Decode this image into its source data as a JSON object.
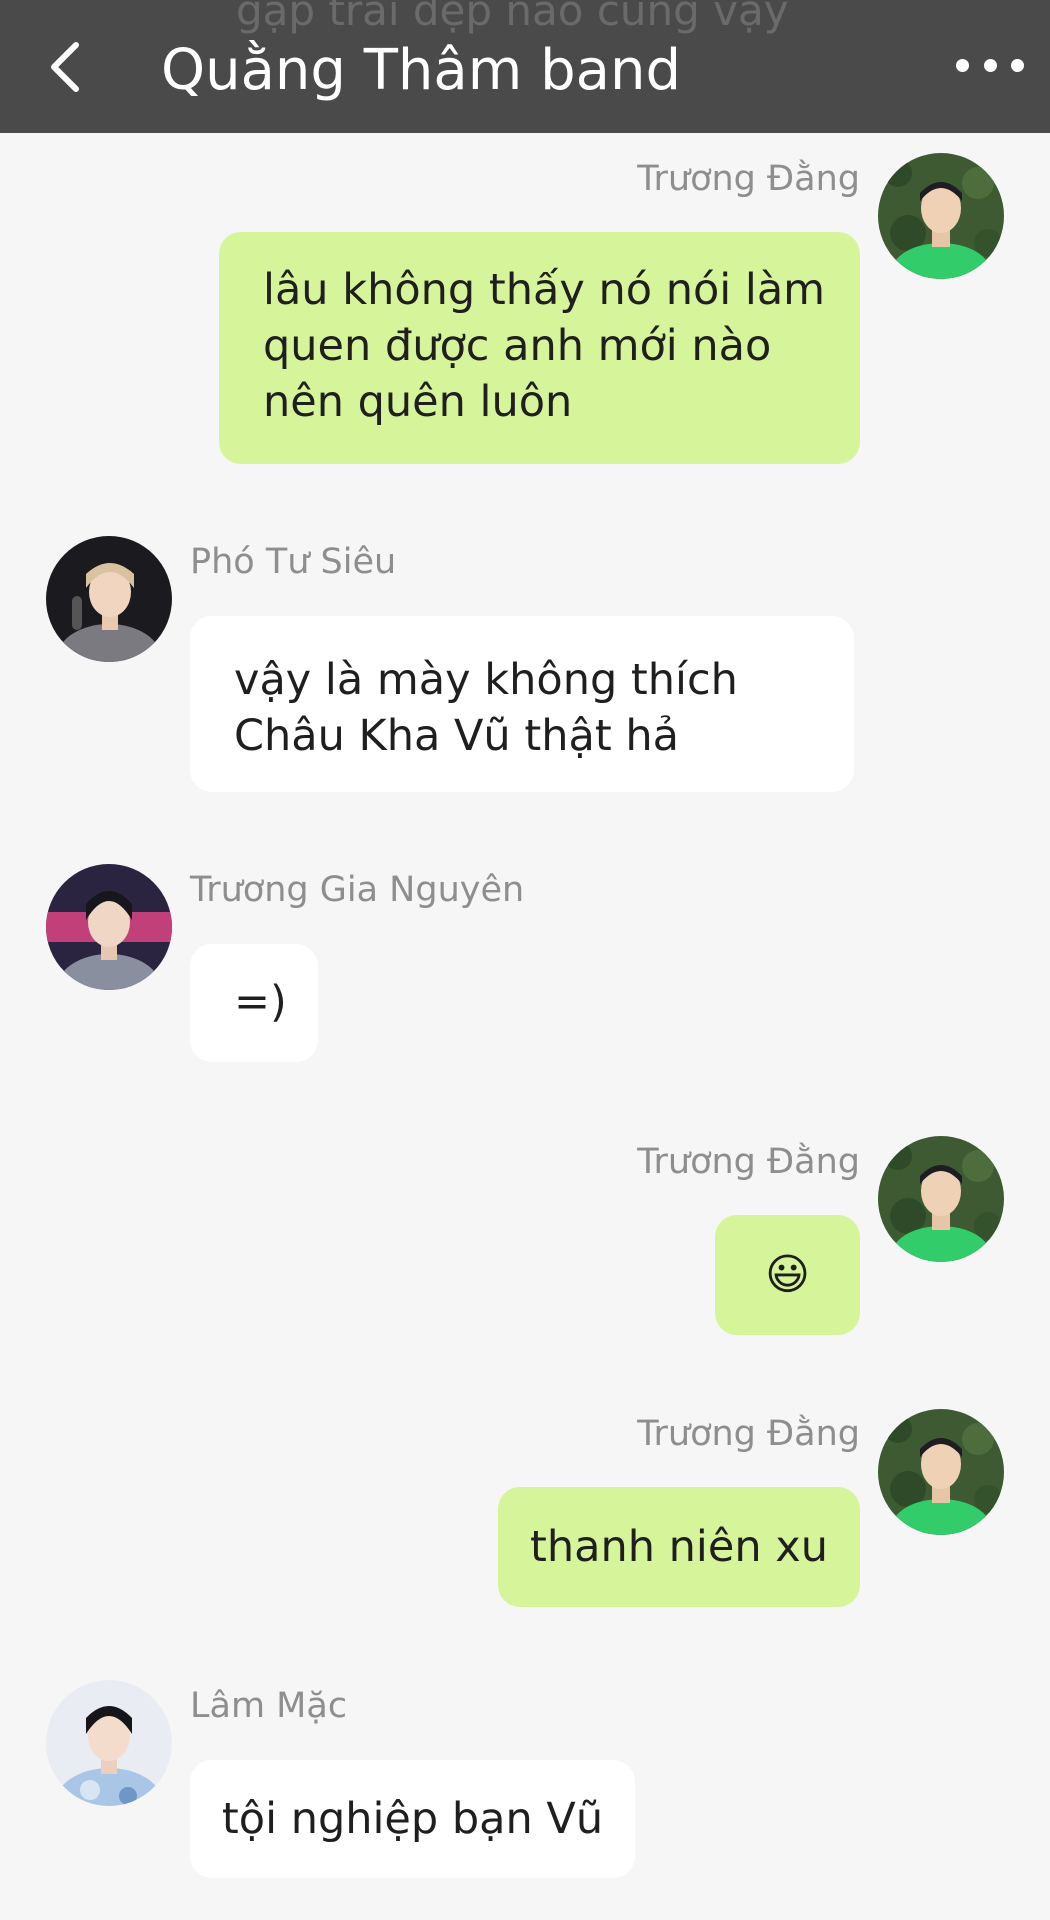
{
  "header": {
    "ghost_text": "gặp trai đẹp nào cũng vậy",
    "title": "Quằng Thâm band",
    "back_icon": "chevron-left-icon",
    "more_icon": "more-dots-icon"
  },
  "messages": [
    {
      "sender": "Trương Đằng",
      "side": "right",
      "text_lines": [
        "lâu không thấy nó nói làm",
        "quen được anh mới nào",
        "nên quên luôn"
      ]
    },
    {
      "sender": "Phó Tư Siêu",
      "side": "left",
      "text_lines": [
        "vậy là mày không thích",
        "Châu Kha Vũ thật hả"
      ]
    },
    {
      "sender": "Trương Gia Nguyên",
      "side": "left",
      "text_lines": [
        "=)"
      ]
    },
    {
      "sender": "Trương Đằng",
      "side": "right",
      "text_lines": [
        "😃"
      ]
    },
    {
      "sender": "Trương Đằng",
      "side": "right",
      "text_lines": [
        "thanh niên xu"
      ]
    },
    {
      "sender": "Lâm Mặc",
      "side": "left",
      "text_lines": [
        "tội nghiệp bạn Vũ"
      ]
    }
  ],
  "colors": {
    "header_bg": "#4a4a4a",
    "chat_bg": "#f6f6f6",
    "outgoing_bubble": "#d6f59a",
    "incoming_bubble": "#ffffff",
    "sender_name": "#8e8e8e"
  }
}
